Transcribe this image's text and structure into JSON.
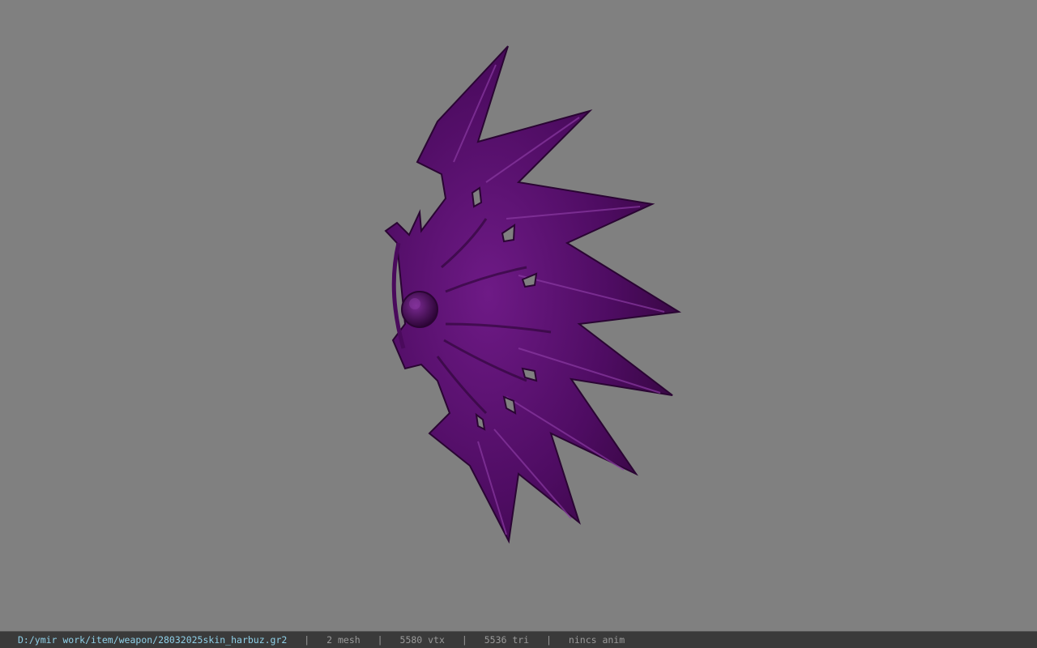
{
  "viewer": {
    "background_color": "#808080",
    "model_color": "#5a0f6e",
    "model_icon": "purple-winged-weapon-model"
  },
  "statusbar": {
    "file_path": "D:/ymir work/item/weapon/28032025skin_harbuz.gr2",
    "mesh_count": "2 mesh",
    "vertex_count": "5580 vtx",
    "triangle_count": "5536 tri",
    "animation_status": "nincs anim",
    "separator": "|"
  }
}
